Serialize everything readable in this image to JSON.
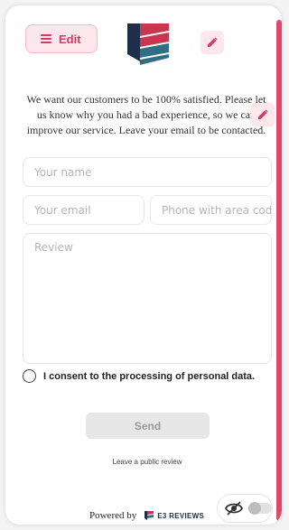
{
  "header": {
    "edit_label": "Edit",
    "edit_icon": "hamburger-menu-icon",
    "logo_icon": "shield-logo-icon",
    "pencil_icon": "pencil-icon"
  },
  "message": "We want our customers to be 100% satisfied. Please let us know why you had a bad experience, so we can improve our service. Leave your email to be contacted.",
  "form": {
    "name_placeholder": "Your name",
    "email_placeholder": "Your email",
    "phone_placeholder": "Phone with area code",
    "review_placeholder": "Review",
    "consent_label": "I consent to the processing of personal data.",
    "send_label": "Send"
  },
  "public_review_link": "Leave a public review",
  "footer": {
    "powered_by": "Powered by",
    "brand_name": "E3 REVIEWS",
    "visibility_icon": "eye-off-icon",
    "toggle_state": "off"
  },
  "colors": {
    "accent": "#e0486b",
    "accent_light": "#fde6ec",
    "accent_dark": "#d23b62",
    "logo_navy": "#1d2f4a",
    "logo_red": "#c9364f",
    "logo_teal": "#2f6f86"
  }
}
